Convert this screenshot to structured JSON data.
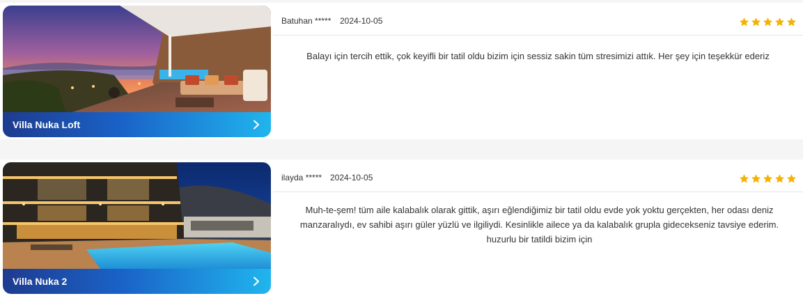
{
  "reviews": [
    {
      "villa_name": "Villa Nuka Loft",
      "reviewer": "Batuhan *****",
      "date": "2024-10-05",
      "rating": 5,
      "text": "Balayı için tercih ettik, çok keyifli bir tatil oldu bizim için sessiz sakin tüm stresimizi attık. Her şey için teşekkür ederiz"
    },
    {
      "villa_name": "Villa Nuka 2",
      "reviewer": "ilayda *****",
      "date": "2024-10-05",
      "rating": 5,
      "text": "Muh-te-şem! tüm aile kalabalık olarak gittik, aşırı eğlendiğimiz bir tatil oldu evde yok yoktu gerçekten, her odası deniz manzaralıydı, ev sahibi aşırı güler yüzlü ve ilgiliydi. Kesinlikle ailece ya da kalabalık grupla gidecekseniz tavsiye ederim. huzurlu bir tatildi bizim için"
    }
  ],
  "colors": {
    "star": "#f5b301",
    "bar_start": "#1e3b8f",
    "bar_end": "#20b5ee"
  },
  "icons": {
    "star": "star-icon",
    "chevron": "chevron-right-icon"
  }
}
